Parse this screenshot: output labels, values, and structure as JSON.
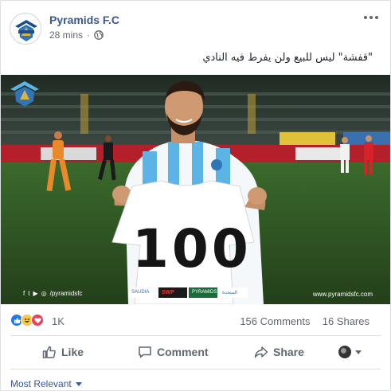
{
  "post": {
    "page_name": "Pyramids F.C",
    "time": "28 mins",
    "separator": "·",
    "text": "\"قفشة\" ليس للبيع ولن يفرط فيه النادي"
  },
  "photo": {
    "jersey_number": "100",
    "social_handle": "/pyramidsfc",
    "site_url": "www.pyramidsfc.com",
    "sponsors": [
      "SAUDIA",
      "SWP",
      "PYRAMIDS",
      "المتحدة"
    ]
  },
  "reactions": {
    "types": [
      "like-icon",
      "haha-icon",
      "love-icon"
    ],
    "count": "1K",
    "comments": "156 Comments",
    "shares": "16 Shares"
  },
  "actions": {
    "like_label": "Like",
    "comment_label": "Comment",
    "share_label": "Share"
  },
  "comments_filter": {
    "label": "Most Relevant"
  },
  "colors": {
    "link": "#385898",
    "secondary": "#606770",
    "like_blue": "#2078f4",
    "love_red": "#f33e58",
    "haha_yellow": "#f7c948",
    "jersey_blue": "#5bb4e5"
  }
}
